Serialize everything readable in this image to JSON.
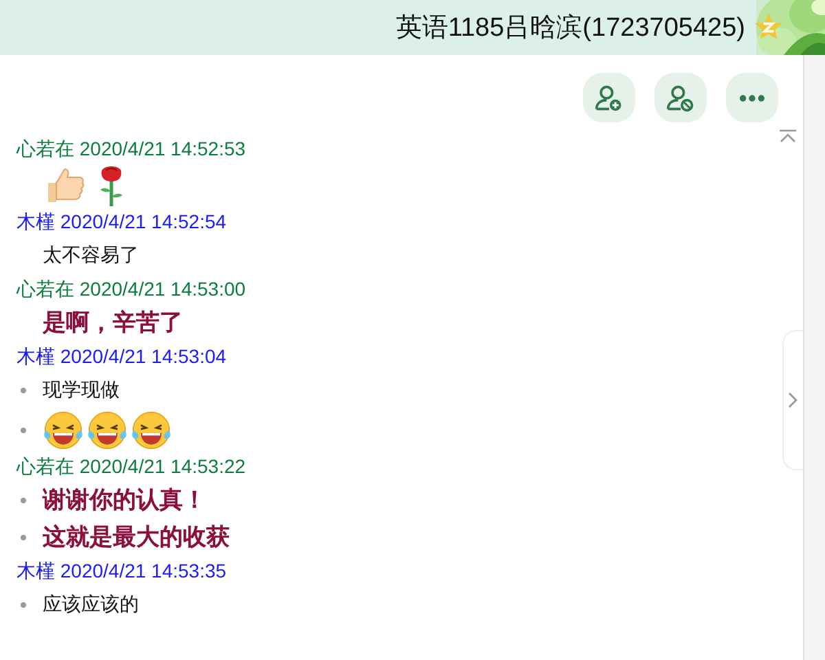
{
  "window": {
    "title": "英语1185吕晗滨(1723705425)"
  },
  "toolbar": {
    "buttons": [
      {
        "kind": "add-person"
      },
      {
        "kind": "remove-person"
      },
      {
        "kind": "more"
      }
    ]
  },
  "messages": [
    {
      "sender": "心若在",
      "time": "2020/4/21 14:52:53",
      "color": "#0a7d3c",
      "lines": [
        {
          "kind": "emoji",
          "bulleted": false,
          "icons": [
            {
              "kind": "thumbs"
            },
            {
              "kind": "rose"
            }
          ]
        }
      ]
    },
    {
      "sender": "木槿",
      "time": "2020/4/21 14:52:54",
      "color": "#1a1aff",
      "lines": [
        {
          "kind": "text",
          "bulleted": false,
          "text": "太不容易了"
        }
      ]
    },
    {
      "sender": "心若在",
      "time": "2020/4/21 14:53:00",
      "color": "#0a7d3c",
      "lines": [
        {
          "kind": "styled",
          "bulleted": false,
          "text": "是啊，辛苦了"
        }
      ]
    },
    {
      "sender": "木槿",
      "time": "2020/4/21 14:53:04",
      "color": "#1a1aff",
      "lines": [
        {
          "kind": "text",
          "bulleted": true,
          "text": "现学现做"
        },
        {
          "kind": "emoji",
          "bulleted": true,
          "icons": [
            {
              "kind": "laugh"
            },
            {
              "kind": "laugh"
            },
            {
              "kind": "laugh"
            }
          ]
        }
      ]
    },
    {
      "sender": "心若在",
      "time": "2020/4/21 14:53:22",
      "color": "#0a7d3c",
      "lines": [
        {
          "kind": "styled",
          "bulleted": true,
          "text": "谢谢你的认真！"
        },
        {
          "kind": "styled",
          "bulleted": true,
          "text": "这就是最大的收获"
        }
      ]
    },
    {
      "sender": "木槿",
      "time": "2020/4/21 14:53:35",
      "color": "#1a1aff",
      "lines": [
        {
          "kind": "text",
          "bulleted": true,
          "text": "应该应该的"
        }
      ]
    }
  ]
}
